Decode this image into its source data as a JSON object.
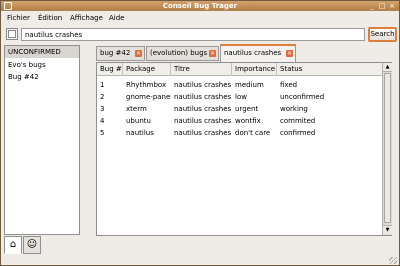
{
  "window": {
    "title": "Conseil Bug Trager"
  },
  "menu": {
    "items": [
      "Fichier",
      "Édition",
      "Affichage",
      "Aide"
    ]
  },
  "search": {
    "value": "nautilus crashes",
    "button_label": "Search"
  },
  "sidebar": {
    "items": [
      "UNCONFIRMED",
      "Evo's bugs",
      "Bug #42"
    ]
  },
  "tabs": [
    {
      "label": "bug #42",
      "active": false
    },
    {
      "label": "(evolution) bugs",
      "active": false
    },
    {
      "label": "nautilus crashes",
      "active": true
    }
  ],
  "table": {
    "columns": [
      "Bug #",
      "Package",
      "Titre",
      "Importance",
      "Status"
    ],
    "rows": [
      [
        "1",
        "Rhythmbox",
        "nautilus crashes",
        "medium",
        "fixed"
      ],
      [
        "2",
        "gnome-panel",
        "nautilus crashes",
        "low",
        "unconfirmed"
      ],
      [
        "3",
        "xterm",
        "nautilus crashes",
        "urgent",
        "working"
      ],
      [
        "4",
        "ubuntu",
        "nautilus crashes",
        "wontfix",
        "commited"
      ],
      [
        "5",
        "nautilus",
        "nautilus crashes",
        "don't care",
        "confirmed"
      ]
    ]
  },
  "bottom_tabs": [
    "home-icon",
    "people-icon"
  ],
  "colors": {
    "accent": "#e07f3b",
    "titlebar": "#c08c55",
    "close": "#e06c3a"
  }
}
